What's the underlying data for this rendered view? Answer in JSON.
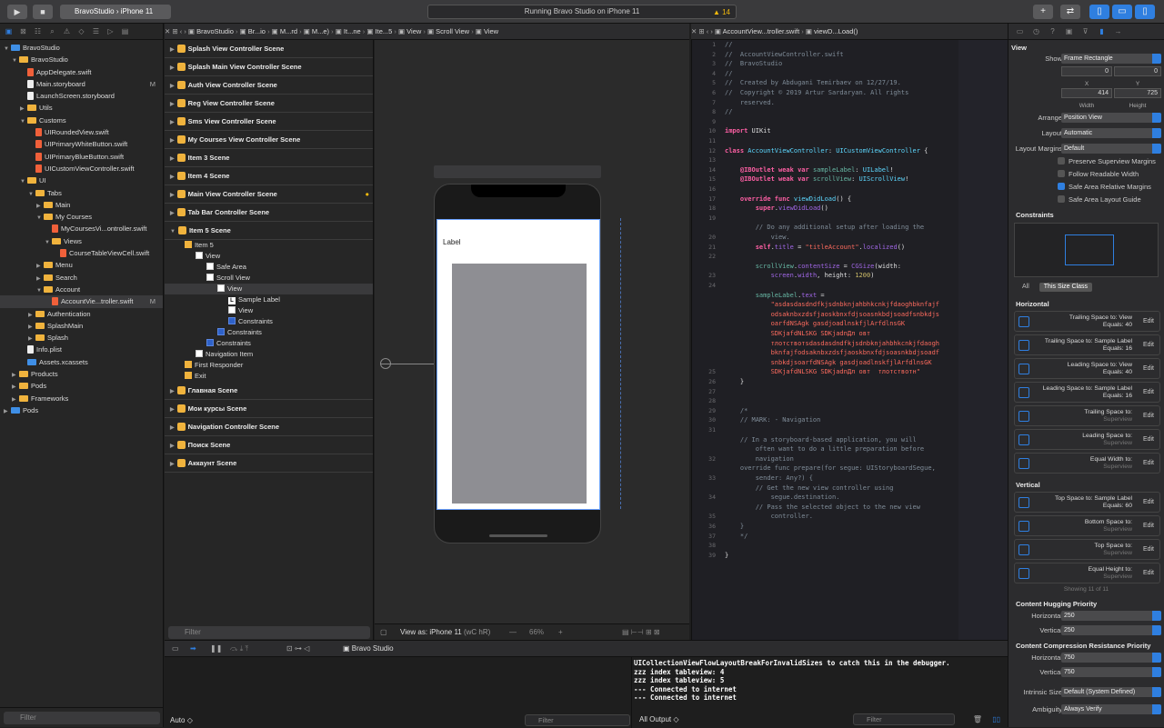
{
  "toolbar": {
    "scheme_app": "BravoStudio",
    "scheme_device": "iPhone 11",
    "status": "Running Bravo Studio on iPhone 11",
    "warnings": "14"
  },
  "navigator": {
    "items": [
      {
        "label": "BravoStudio",
        "kind": "project",
        "depth": 0,
        "open": true
      },
      {
        "label": "BravoStudio",
        "kind": "folder",
        "depth": 1,
        "open": true
      },
      {
        "label": "AppDelegate.swift",
        "kind": "swift",
        "depth": 2
      },
      {
        "label": "Main.storyboard",
        "kind": "file",
        "depth": 2,
        "badge": "M"
      },
      {
        "label": "LaunchScreen.storyboard",
        "kind": "file",
        "depth": 2
      },
      {
        "label": "Utils",
        "kind": "folder",
        "depth": 2,
        "open": false
      },
      {
        "label": "Customs",
        "kind": "folder",
        "depth": 2,
        "open": true
      },
      {
        "label": "UIRoundedView.swift",
        "kind": "swift",
        "depth": 3
      },
      {
        "label": "UIPrimaryWhiteButton.swift",
        "kind": "swift",
        "depth": 3
      },
      {
        "label": "UIPrimaryBlueButton.swift",
        "kind": "swift",
        "depth": 3
      },
      {
        "label": "UICustomViewController.swift",
        "kind": "swift",
        "depth": 3
      },
      {
        "label": "UI",
        "kind": "folder",
        "depth": 2,
        "open": true
      },
      {
        "label": "Tabs",
        "kind": "folder",
        "depth": 3,
        "open": true
      },
      {
        "label": "Main",
        "kind": "folder",
        "depth": 4,
        "open": false
      },
      {
        "label": "My Courses",
        "kind": "folder",
        "depth": 4,
        "open": true
      },
      {
        "label": "MyCoursesVi...ontroller.swift",
        "kind": "swift",
        "depth": 5
      },
      {
        "label": "Views",
        "kind": "folder",
        "depth": 5,
        "open": true
      },
      {
        "label": "CourseTableViewCell.swift",
        "kind": "swift",
        "depth": 6
      },
      {
        "label": "Menu",
        "kind": "folder",
        "depth": 4,
        "open": false
      },
      {
        "label": "Search",
        "kind": "folder",
        "depth": 4,
        "open": false
      },
      {
        "label": "Account",
        "kind": "folder",
        "depth": 4,
        "open": true
      },
      {
        "label": "AccountVie...troller.swift",
        "kind": "swift",
        "depth": 5,
        "badge": "M",
        "selected": true
      },
      {
        "label": "Authentication",
        "kind": "folder",
        "depth": 3,
        "open": false
      },
      {
        "label": "SplashMain",
        "kind": "folder",
        "depth": 3,
        "open": false
      },
      {
        "label": "Splash",
        "kind": "folder",
        "depth": 3,
        "open": false
      },
      {
        "label": "Info.plist",
        "kind": "file",
        "depth": 2
      },
      {
        "label": "Assets.xcassets",
        "kind": "blue",
        "depth": 2
      },
      {
        "label": "Products",
        "kind": "folder",
        "depth": 1,
        "open": false
      },
      {
        "label": "Pods",
        "kind": "folder",
        "depth": 1,
        "open": false
      },
      {
        "label": "Frameworks",
        "kind": "folder",
        "depth": 1,
        "open": false
      },
      {
        "label": "Pods",
        "kind": "project",
        "depth": 0,
        "open": false
      }
    ],
    "filter_placeholder": "Filter"
  },
  "storyboard_jump": [
    "BravoStudio",
    "Br...io",
    "M...rd",
    "M...e)",
    "It...ne",
    "Ite...5",
    "View",
    "Scroll View",
    "View"
  ],
  "editor_jump": [
    "AccountView...troller.swift",
    "viewD...Load()"
  ],
  "outline": {
    "scenes_top": [
      "Splash View Controller Scene",
      "Splash Main View Controller Scene",
      "Auth View Controller Scene",
      "Reg View Controller Scene",
      "Sms View Controller Scene",
      "My Courses View Controller Scene",
      "Item 3 Scene",
      "Item 4 Scene",
      "Main View Controller Scene",
      "Tab Bar Controller Scene",
      "Item 5 Scene"
    ],
    "tree": [
      {
        "label": "Item 5",
        "depth": 1,
        "icon": "yel"
      },
      {
        "label": "View",
        "depth": 2,
        "icon": "white"
      },
      {
        "label": "Safe Area",
        "depth": 3,
        "icon": "white"
      },
      {
        "label": "Scroll View",
        "depth": 3,
        "icon": "white"
      },
      {
        "label": "View",
        "depth": 4,
        "icon": "white",
        "selected": true
      },
      {
        "label": "Sample Label",
        "depth": 5,
        "icon": "L"
      },
      {
        "label": "View",
        "depth": 5,
        "icon": "white"
      },
      {
        "label": "Constraints",
        "depth": 5,
        "icon": "blue"
      },
      {
        "label": "Constraints",
        "depth": 4,
        "icon": "blue"
      },
      {
        "label": "Constraints",
        "depth": 3,
        "icon": "blue"
      },
      {
        "label": "Navigation Item",
        "depth": 2,
        "icon": "white"
      },
      {
        "label": "First Responder",
        "depth": 1,
        "icon": "yel"
      },
      {
        "label": "Exit",
        "depth": 1,
        "icon": "yel"
      }
    ],
    "scenes_bottom": [
      "Главная Scene",
      "Мои курсы Scene",
      "Navigation Controller Scene",
      "Поиск Scene",
      "Аккаунт Scene"
    ],
    "filter_placeholder": "Filter"
  },
  "canvas": {
    "label_text": "Label",
    "view_as": "View as: iPhone 11",
    "view_as_suffix": "(wC hR)",
    "zoom": "66%"
  },
  "editor": {
    "line_numbers": [
      "1",
      "2",
      "3",
      "4",
      "5",
      "6",
      "7",
      "8",
      "9",
      "10",
      "11",
      "12",
      "13",
      "14",
      "15",
      "16",
      "17",
      "18",
      "19",
      "",
      "20",
      "21",
      "22",
      "",
      "23",
      "24",
      "",
      "",
      "",
      "",
      "",
      "",
      "",
      "",
      "25",
      "26",
      "27",
      "28",
      "29",
      "30",
      "31",
      "",
      "",
      "32",
      "",
      "33",
      "",
      "34",
      "",
      "35",
      "36",
      "37",
      "38",
      "39"
    ],
    "lines": [
      [
        [
          "cm",
          "//"
        ]
      ],
      [
        [
          "cm",
          "//  AccountViewController.swift"
        ]
      ],
      [
        [
          "cm",
          "//  BravoStudio"
        ]
      ],
      [
        [
          "cm",
          "//"
        ]
      ],
      [
        [
          "cm",
          "//  Created by Abdugani Temirbaev on 12/27/19."
        ]
      ],
      [
        [
          "cm",
          "//  Copyright © 2019 Artur Sardaryan. All rights"
        ]
      ],
      [
        [
          "cm",
          "    reserved."
        ]
      ],
      [
        [
          "cm",
          "//"
        ]
      ],
      [
        [
          "pl",
          ""
        ]
      ],
      [
        [
          "kw",
          "import"
        ],
        [
          "pl",
          " UIKit"
        ]
      ],
      [
        [
          "pl",
          ""
        ]
      ],
      [
        [
          "kw",
          "class"
        ],
        [
          "pl",
          " "
        ],
        [
          "ty",
          "AccountViewController"
        ],
        [
          "pl",
          ": "
        ],
        [
          "ty",
          "UICustomViewController"
        ],
        [
          "pl",
          " {"
        ]
      ],
      [
        [
          "pl",
          ""
        ]
      ],
      [
        [
          "pl",
          "    "
        ],
        [
          "kw",
          "@IBOutlet weak var"
        ],
        [
          "pl",
          " "
        ],
        [
          "pr",
          "sampleLabel"
        ],
        [
          "pl",
          ": "
        ],
        [
          "ty",
          "UILabel"
        ],
        [
          "pl",
          "!"
        ]
      ],
      [
        [
          "pl",
          "    "
        ],
        [
          "kw",
          "@IBOutlet weak var"
        ],
        [
          "pl",
          " "
        ],
        [
          "pr",
          "scrollView"
        ],
        [
          "pl",
          ": "
        ],
        [
          "ty",
          "UIScrollView"
        ],
        [
          "pl",
          "!"
        ]
      ],
      [
        [
          "pl",
          ""
        ]
      ],
      [
        [
          "pl",
          "    "
        ],
        [
          "kw",
          "override func"
        ],
        [
          "pl",
          " "
        ],
        [
          "ty",
          "viewDidLoad"
        ],
        [
          "pl",
          "() {"
        ]
      ],
      [
        [
          "pl",
          "        "
        ],
        [
          "kw",
          "super"
        ],
        [
          "pl",
          "."
        ],
        [
          "fn",
          "viewDidLoad"
        ],
        [
          "pl",
          "()"
        ]
      ],
      [
        [
          "pl",
          ""
        ]
      ],
      [
        [
          "cm",
          "        // Do any additional setup after loading the"
        ]
      ],
      [
        [
          "cm",
          "            view."
        ]
      ],
      [
        [
          "pl",
          "        "
        ],
        [
          "kw",
          "self"
        ],
        [
          "pl",
          "."
        ],
        [
          "fn",
          "title"
        ],
        [
          "pl",
          " = "
        ],
        [
          "st",
          "\"titleAccount\""
        ],
        [
          "pl",
          "."
        ],
        [
          "fn",
          "localized"
        ],
        [
          "pl",
          "()"
        ]
      ],
      [
        [
          "pl",
          ""
        ]
      ],
      [
        [
          "pl",
          "        "
        ],
        [
          "pr",
          "scrollView"
        ],
        [
          "pl",
          "."
        ],
        [
          "fn",
          "contentSize"
        ],
        [
          "pl",
          " = "
        ],
        [
          "fn",
          "CGSize"
        ],
        [
          "pl",
          "(width:"
        ]
      ],
      [
        [
          "pl",
          "            "
        ],
        [
          "fn",
          "screen"
        ],
        [
          "pl",
          "."
        ],
        [
          "fn",
          "width"
        ],
        [
          "pl",
          ", height: "
        ],
        [
          "nm",
          "1200"
        ],
        [
          "pl",
          ")"
        ]
      ],
      [
        [
          "pl",
          ""
        ]
      ],
      [
        [
          "pl",
          "        "
        ],
        [
          "pr",
          "sampleLabel"
        ],
        [
          "pl",
          "."
        ],
        [
          "fn",
          "text"
        ],
        [
          "pl",
          " ="
        ]
      ],
      [
        [
          "st",
          "            \"asdasdasdndfkjsdnbknjahbhkcnkjfdaoghbknfajf"
        ]
      ],
      [
        [
          "st",
          "            odsaknbxzdsfjaoskbnxfdjsoasnkbdjsoadfsnbkdjs"
        ]
      ],
      [
        [
          "st",
          "            oarfdNSAgk gasdjoadlnskfjlArfdlnsGK"
        ]
      ],
      [
        [
          "st",
          "            SDKjafdNLSKG SDKjadnДл овт"
        ]
      ],
      [
        [
          "st",
          "            тлотствотsdasdasdndfkjsdnbknjahbhkcnkjfdaogh"
        ]
      ],
      [
        [
          "st",
          "            bknfajfodsaknbxzdsfjaoskbnxfdjsoasnkbdjsoadf"
        ]
      ],
      [
        [
          "st",
          "            snbkdjsoarfdNSAgk gasdjoadlnskfjlArfdlnsGK"
        ]
      ],
      [
        [
          "st",
          "            SDKjafdNLSKG SDKjadnДл овт  тлотствотн\""
        ]
      ],
      [
        [
          "pl",
          "    }"
        ]
      ],
      [
        [
          "pl",
          ""
        ]
      ],
      [
        [
          "pl",
          ""
        ]
      ],
      [
        [
          "cm",
          "    /*"
        ]
      ],
      [
        [
          "cm",
          "    // MARK: - Navigation"
        ]
      ],
      [
        [
          "pl",
          ""
        ]
      ],
      [
        [
          "cm",
          "    // In a storyboard-based application, you will"
        ]
      ],
      [
        [
          "cm",
          "        often want to do a little preparation before"
        ]
      ],
      [
        [
          "cm",
          "        navigation"
        ]
      ],
      [
        [
          "cm",
          "    override func prepare(for segue: UIStoryboardSegue,"
        ]
      ],
      [
        [
          "cm",
          "        sender: Any?) {"
        ]
      ],
      [
        [
          "cm",
          "        // Get the new view controller using"
        ]
      ],
      [
        [
          "cm",
          "            segue.destination."
        ]
      ],
      [
        [
          "cm",
          "        // Pass the selected object to the new view"
        ]
      ],
      [
        [
          "cm",
          "            controller."
        ]
      ],
      [
        [
          "cm",
          "    }"
        ]
      ],
      [
        [
          "cm",
          "    */"
        ]
      ],
      [
        [
          "pl",
          ""
        ]
      ],
      [
        [
          "pl",
          "}"
        ]
      ],
      [
        [
          "pl",
          ""
        ]
      ]
    ]
  },
  "inspector": {
    "title": "View",
    "show_label": "Show",
    "show_value": "Frame Rectangle",
    "x": "0",
    "y": "0",
    "x_label": "X",
    "y_label": "Y",
    "width": "414",
    "height": "725",
    "w_label": "Width",
    "h_label": "Height",
    "arrange_label": "Arrange",
    "arrange_value": "Position View",
    "layout_label": "Layout",
    "layout_value": "Automatic",
    "margins_label": "Layout Margins",
    "margins_value": "Default",
    "checks": [
      {
        "label": "Preserve Superview Margins",
        "on": false
      },
      {
        "label": "Follow Readable Width",
        "on": false
      },
      {
        "label": "Safe Area Relative Margins",
        "on": true
      },
      {
        "label": "Safe Area Layout Guide",
        "on": false
      }
    ],
    "constraints_title": "Constraints",
    "all_label": "All",
    "size_class_label": "This Size Class",
    "horizontal_title": "Horizontal",
    "horizontal": [
      {
        "l1": "Trailing Space to: View",
        "l2": "Equals: 40",
        "faded": false
      },
      {
        "l1": "Trailing Space to: Sample Label",
        "l2": "Equals: 16",
        "faded": false
      },
      {
        "l1": "Leading Space to: View",
        "l2": "Equals: 40",
        "faded": false
      },
      {
        "l1": "Leading Space to: Sample Label",
        "l2": "Equals: 16",
        "faded": false
      },
      {
        "l1": "Trailing Space to:",
        "l2": "Superview",
        "faded": true
      },
      {
        "l1": "Leading Space to:",
        "l2": "Superview",
        "faded": true
      },
      {
        "l1": "Equal Width to:",
        "l2": "Superview",
        "faded": true
      }
    ],
    "vertical_title": "Vertical",
    "vertical": [
      {
        "l1": "Top Space to: Sample Label",
        "l2": "Equals: 60",
        "faded": false
      },
      {
        "l1": "Bottom Space to:",
        "l2": "Superview",
        "faded": true
      },
      {
        "l1": "Top Space to:",
        "l2": "Superview",
        "faded": true
      },
      {
        "l1": "Equal Height to:",
        "l2": "Superview",
        "faded": true
      }
    ],
    "edit_label": "Edit",
    "showing": "Showing 11 of 11",
    "hugging_title": "Content Hugging Priority",
    "hug_h_label": "Horizontal",
    "hug_h": "250",
    "hug_v_label": "Vertical",
    "hug_v": "250",
    "compression_title": "Content Compression Resistance Priority",
    "comp_h_label": "Horizontal",
    "comp_h": "750",
    "comp_v_label": "Vertical",
    "comp_v": "750",
    "intrinsic_label": "Intrinsic Size",
    "intrinsic_value": "Default (System Defined)",
    "ambiguity_label": "Ambiguity",
    "ambiguity_value": "Always Verify"
  },
  "debug": {
    "target": "Bravo Studio",
    "auto_label": "Auto",
    "filter_placeholder": "Filter",
    "output_label": "All Output",
    "console": "UICollectionViewFlowLayoutBreakForInvalidSizes to catch this in the debugger.\nzzz index tableview: 4\nzzz index tableview: 5\n--- Connected to internet\n--- Connected to internet"
  }
}
